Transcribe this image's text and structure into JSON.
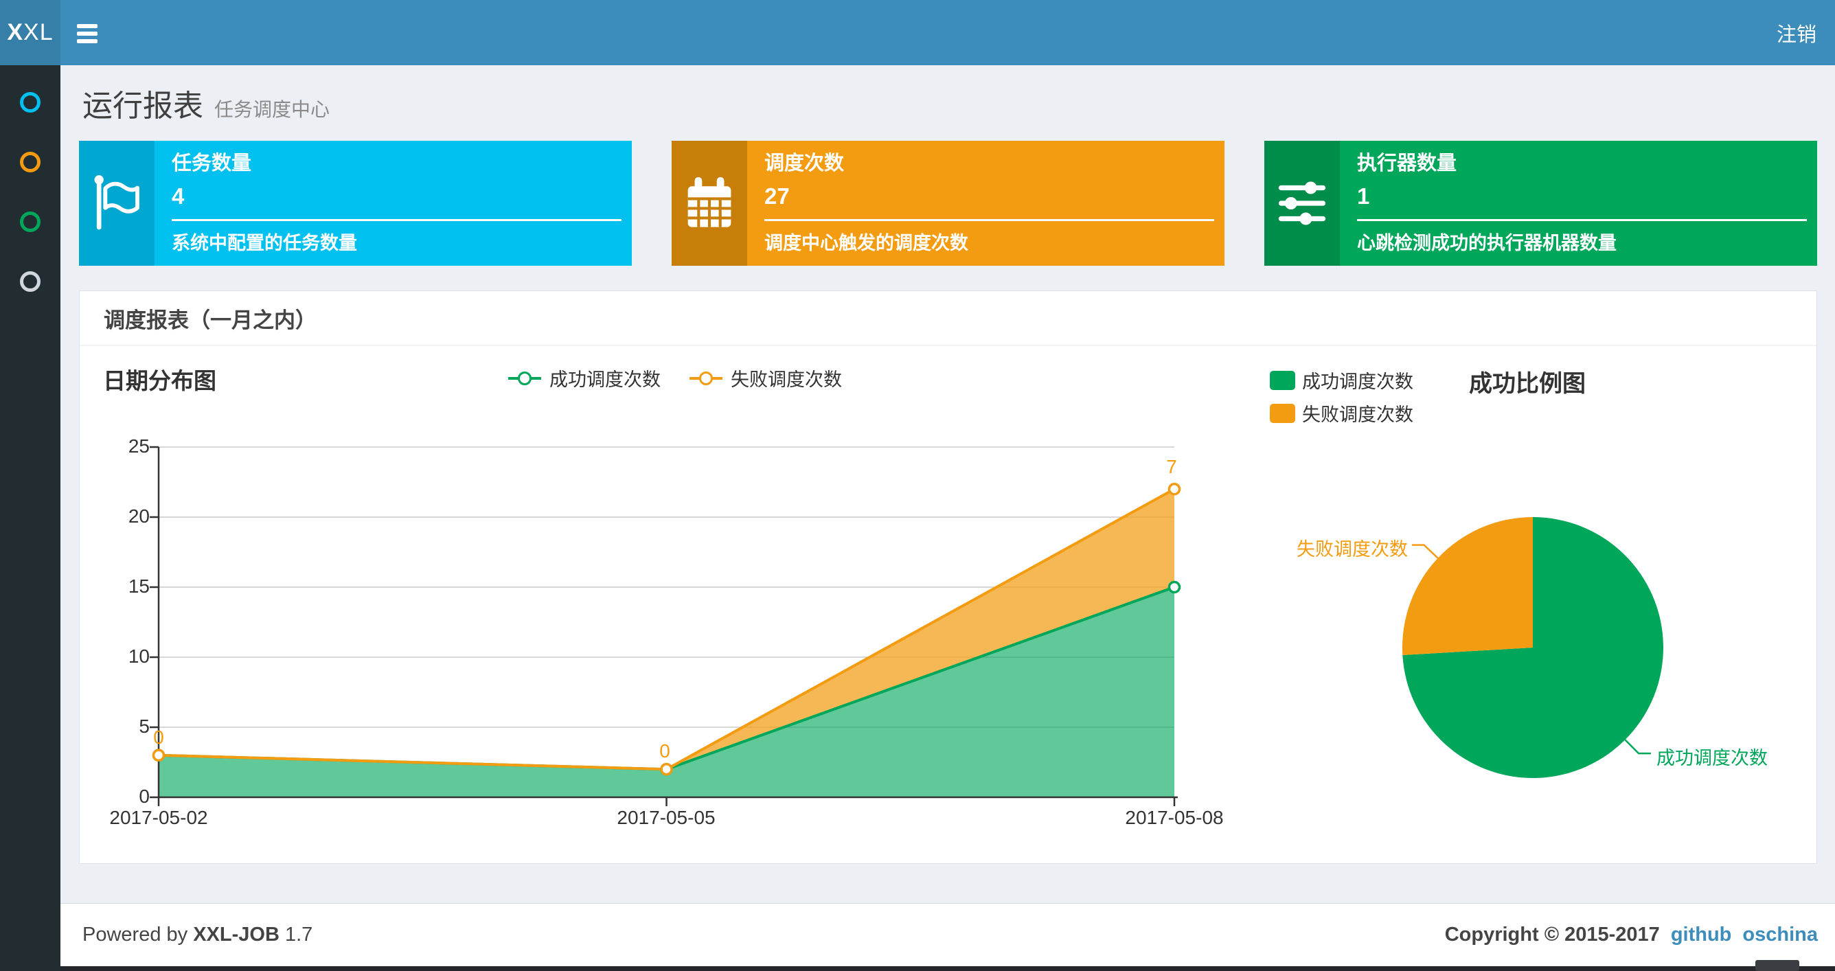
{
  "navbar": {
    "logo_prefix": "X",
    "logo_suffix": "XL",
    "logout_label": "注销"
  },
  "sidebar": {
    "items": [
      {
        "label": "menu-item-1",
        "icon": "circle-o-icon",
        "color": "#00c0ef"
      },
      {
        "label": "menu-item-2",
        "icon": "circle-o-icon",
        "color": "#f39c12"
      },
      {
        "label": "menu-item-3",
        "icon": "circle-o-icon",
        "color": "#00a65a"
      },
      {
        "label": "menu-item-4",
        "icon": "circle-o-icon",
        "color": "#d2d6de"
      }
    ]
  },
  "page_header": {
    "title": "运行报表",
    "subtitle": "任务调度中心"
  },
  "stat_cards": [
    {
      "title": "任务数量",
      "value": "4",
      "desc": "系统中配置的任务数量",
      "bg": "#00c0ef",
      "icon_bg": "#00a7d0",
      "icon": "flag-icon"
    },
    {
      "title": "调度次数",
      "value": "27",
      "desc": "调度中心触发的调度次数",
      "bg": "#f39c12",
      "icon_bg": "#c87f0a",
      "icon": "calendar-icon"
    },
    {
      "title": "执行器数量",
      "value": "1",
      "desc": "心跳检测成功的执行器机器数量",
      "bg": "#00a65a",
      "icon_bg": "#008d4c",
      "icon": "sliders-icon"
    }
  ],
  "panel": {
    "title": "调度报表（一月之内）"
  },
  "chart_data": [
    {
      "type": "area",
      "title": "日期分布图",
      "x": [
        "2017-05-02",
        "2017-05-05",
        "2017-05-08"
      ],
      "series": [
        {
          "name": "成功调度次数",
          "values": [
            3,
            2,
            15
          ],
          "color": "#00a65a",
          "area_opacity": 0.62,
          "marker": "hollow-circle"
        },
        {
          "name": "失败调度次数",
          "values": [
            0,
            0,
            7
          ],
          "color": "#f39c12",
          "area_opacity": 0.72,
          "marker": "hollow-circle",
          "labels": [
            "0",
            "0",
            "7"
          ]
        }
      ],
      "stacked": true,
      "xlabel": "",
      "ylabel": "",
      "ylim": [
        0,
        25
      ],
      "yticks": [
        0,
        5,
        10,
        15,
        20,
        25
      ],
      "grid": true,
      "legend_position": "top-center"
    },
    {
      "type": "pie",
      "title": "成功比例图",
      "slices": [
        {
          "label": "成功调度次数",
          "value": 20,
          "color": "#00a65a"
        },
        {
          "label": "失败调度次数",
          "value": 7,
          "color": "#f39c12"
        }
      ],
      "total": 27,
      "start_angle_deg": 90,
      "direction": "clockwise",
      "legend_position": "top-left"
    }
  ],
  "footer": {
    "powered_prefix": "Powered by ",
    "product": "XXL-JOB",
    "version": " 1.7",
    "copyright": "Copyright © 2015-2017",
    "links": [
      "github",
      "oschina"
    ]
  },
  "colors": {
    "navbar_bg": "#3c8dbc",
    "logo_bg": "#367fa9",
    "sidebar_bg": "#222d32",
    "content_bg": "#ecf0f5",
    "info": "#00c0ef",
    "warning": "#f39c12",
    "success": "#00a65a",
    "link": "#3c8dbc",
    "axis": "#333333",
    "gridline": "#cccccc"
  }
}
